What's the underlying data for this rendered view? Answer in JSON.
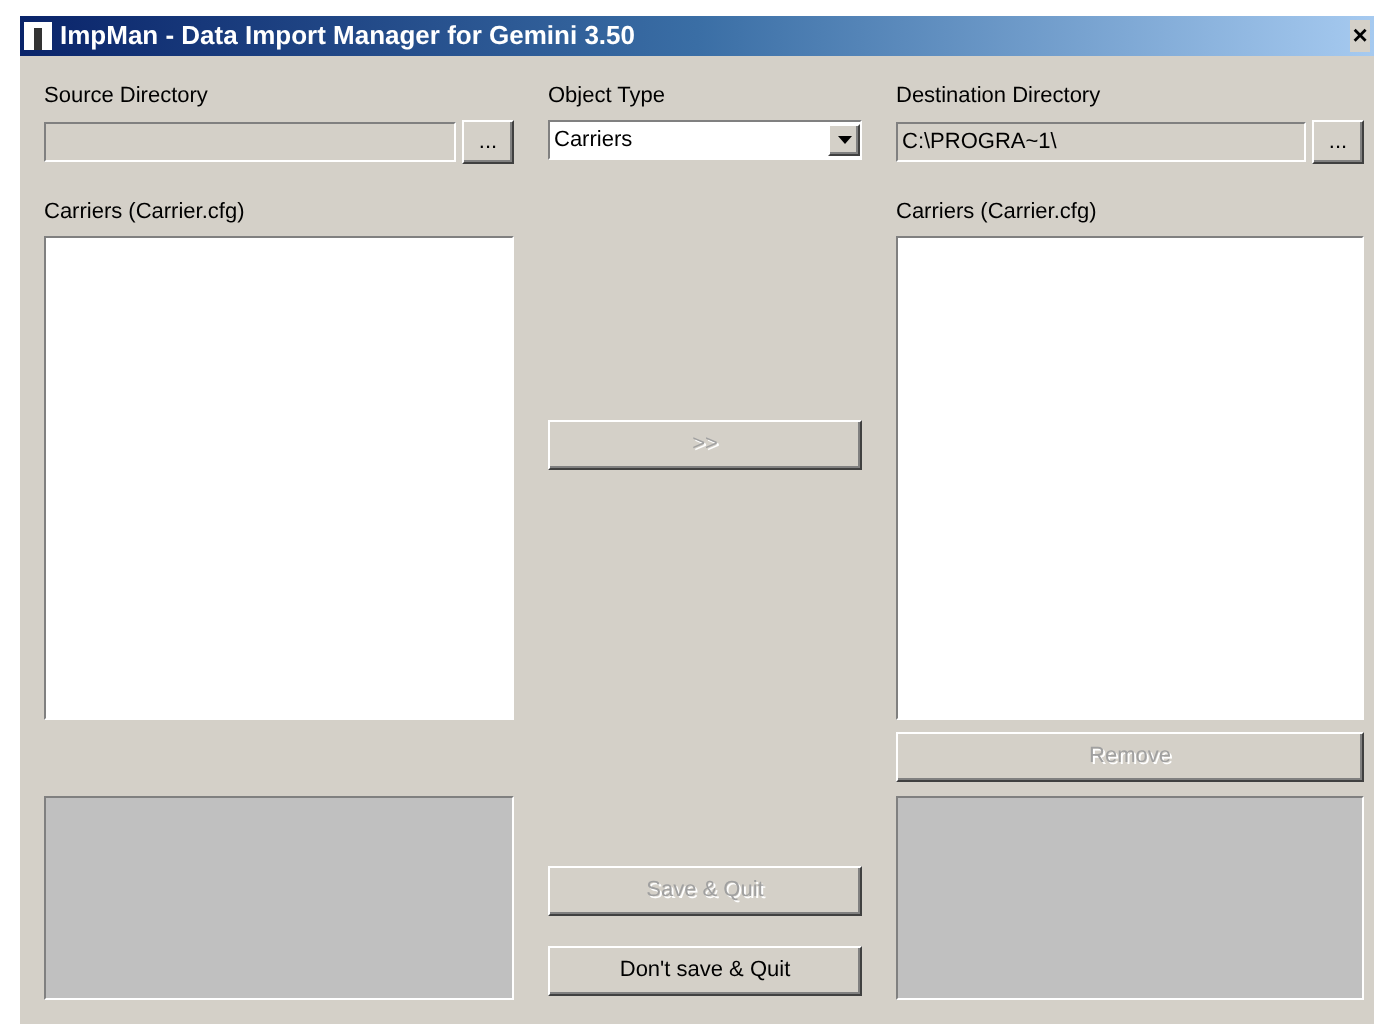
{
  "window": {
    "title": "ImpMan - Data Import Manager for Gemini 3.50",
    "close": "×"
  },
  "source": {
    "label": "Source Directory",
    "disabled": true,
    "browse": "..."
  },
  "object_type": {
    "label": "Object Type",
    "value": "Carriers"
  },
  "destination": {
    "label": "Destination Directory",
    "value": "C:\\PROGRA~1\\",
    "disabled": true,
    "browse": "..."
  },
  "source_list": {
    "label": "Carriers (Carrier.cfg)"
  },
  "destination_list": {
    "label": "Carriers (Carrier.cfg)"
  },
  "transfer_button": {
    "label": ">>",
    "disabled": true
  },
  "remove_button": {
    "label": "Remove",
    "disabled": true
  },
  "save_button": {
    "label": "Save & Quit",
    "disabled": true
  },
  "quit_button": {
    "label": "Don't save & Quit",
    "disabled": false
  }
}
